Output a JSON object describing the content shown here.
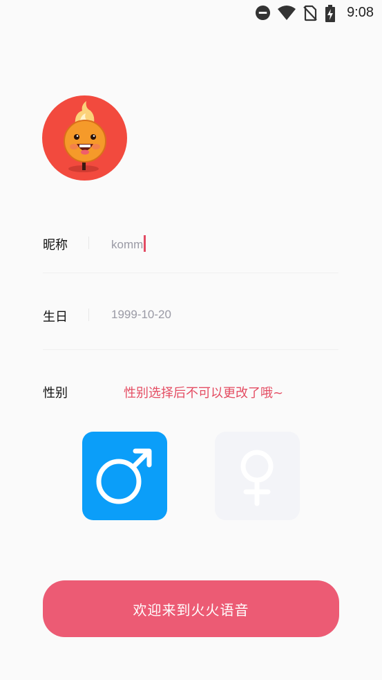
{
  "status_bar": {
    "time": "9:08",
    "icons": [
      "do-not-disturb-icon",
      "wifi-icon",
      "no-sim-icon",
      "battery-charging-icon"
    ]
  },
  "profile": {
    "avatar_icon": "fire-mascot-avatar"
  },
  "form": {
    "nickname": {
      "label": "昵称",
      "value": "komm"
    },
    "birthday": {
      "label": "生日",
      "value": "1999-10-20"
    },
    "gender": {
      "label": "性别",
      "hint": "性别选择后不可以更改了哦~",
      "selected": "male",
      "male_icon": "male-symbol-icon",
      "female_icon": "female-symbol-icon"
    }
  },
  "submit_label": "欢迎来到火火语音",
  "colors": {
    "accent": "#ec5b74",
    "hint": "#e44c62",
    "male_selected": "#0b9ef9",
    "female_unselected": "#f3f4f8",
    "avatar_bg": "#f24a3e"
  }
}
